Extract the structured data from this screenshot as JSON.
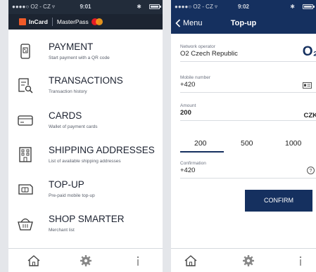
{
  "left_phone": {
    "status": {
      "carrier": "●●●●○ O2 - CZ ▿",
      "time": "9:01",
      "bluetooth": "✱"
    },
    "brand": {
      "name": "InCard",
      "partner": "MasterPass"
    },
    "menu": [
      {
        "title": "PAYMENT",
        "subtitle": "Start payment with a QR code",
        "icon": "qr-phone-icon"
      },
      {
        "title": "TRANSACTIONS",
        "subtitle": "Transaction history",
        "icon": "document-search-icon"
      },
      {
        "title": "CARDS",
        "subtitle": "Wallet of payment cards",
        "icon": "card-icon"
      },
      {
        "title": "SHIPPING ADDRESSES",
        "subtitle": "List of available shipping addresses",
        "icon": "building-icon"
      },
      {
        "title": "TOP-UP",
        "subtitle": "Pre-paid mobile top-up",
        "icon": "sim-card-icon"
      },
      {
        "title": "SHOP SMARTER",
        "subtitle": "Merchant list",
        "icon": "basket-icon"
      }
    ],
    "tabs": [
      "home-icon",
      "gear-icon",
      "info-icon"
    ]
  },
  "right_phone": {
    "status": {
      "carrier": "●●●●○ O2 - CZ ▿",
      "time": "9:02",
      "bluetooth": "✱"
    },
    "nav": {
      "back_label": "Menu",
      "title": "Top-up"
    },
    "operator": {
      "label": "Network operator",
      "value": "O2 Czech Republic",
      "logo": "O₂"
    },
    "mobile": {
      "label": "Mobile number",
      "value": "+420"
    },
    "amount": {
      "label": "Amount",
      "value": "200",
      "currency": "CZK"
    },
    "amount_options": [
      "200",
      "500",
      "1000"
    ],
    "selected_amount": "200",
    "confirmation": {
      "label": "Confirmation",
      "value": "+420",
      "help": "?"
    },
    "confirm_button": "CONFIRM",
    "tabs": [
      "home-icon",
      "gear-icon",
      "info-icon"
    ]
  },
  "colors": {
    "navy": "#15305f",
    "orange": "#f05a28",
    "dark_header": "#1c2431"
  }
}
